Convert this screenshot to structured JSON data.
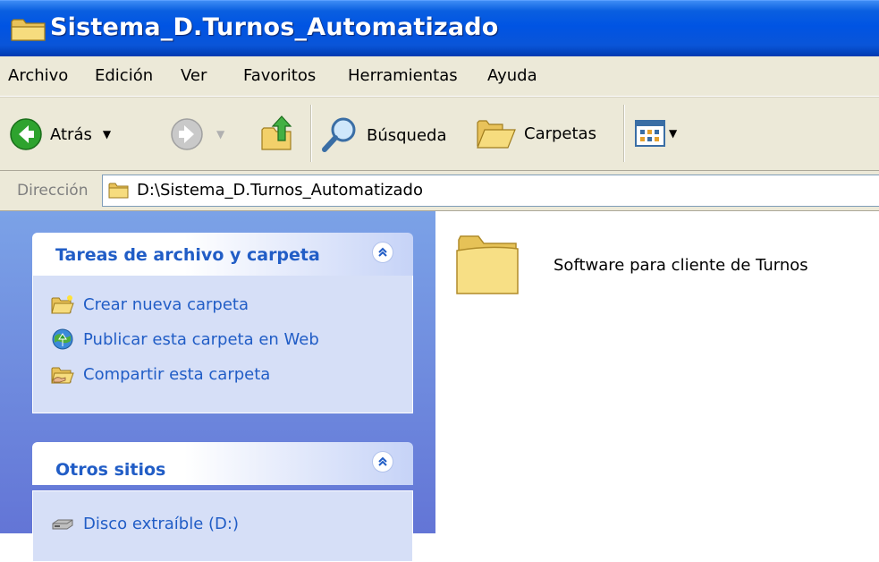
{
  "window": {
    "title": "Sistema_D.Turnos_Automatizado",
    "folder_icon": "folder-icon"
  },
  "menu": {
    "items": [
      "Archivo",
      "Edición",
      "Ver",
      "Favoritos",
      "Herramientas",
      "Ayuda"
    ]
  },
  "toolbar": {
    "back_label": "Atrás",
    "search_label": "Búsqueda",
    "folders_label": "Carpetas"
  },
  "address": {
    "label": "Dirección",
    "value": "D:\\Sistema_D.Turnos_Automatizado"
  },
  "task_pane": {
    "file_tasks": {
      "title": "Tareas de archivo y carpeta",
      "items": [
        {
          "label": "Crear nueva carpeta",
          "icon": "new-folder-icon"
        },
        {
          "label": "Publicar esta carpeta en Web",
          "icon": "publish-web-icon"
        },
        {
          "label": "Compartir esta carpeta",
          "icon": "share-folder-icon"
        }
      ]
    },
    "other_places": {
      "title": "Otros sitios",
      "items": [
        {
          "label": "Disco extraíble (D:)",
          "icon": "removable-disk-icon"
        }
      ]
    }
  },
  "content": {
    "items": [
      {
        "name": "Software para cliente de Turnos",
        "icon": "folder-icon"
      }
    ]
  },
  "colors": {
    "title_bar": "#0054e3",
    "chrome": "#ece9d8",
    "task_pane_bg": "#7ba2e7",
    "task_link": "#215dc6",
    "panel_body": "#d6dff7"
  }
}
